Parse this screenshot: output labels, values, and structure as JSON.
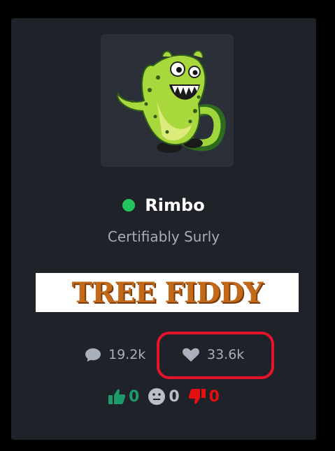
{
  "profile": {
    "name": "Rimbo",
    "subtitle": "Certifiably Surly",
    "status": "online",
    "status_color": "#22c55e",
    "banner_text": "TREE FIDDY"
  },
  "stats": {
    "comments": "19.2k",
    "likes": "33.6k"
  },
  "reactions": {
    "thumbs_up": "0",
    "neutral": "0",
    "thumbs_down": "0",
    "up_color": "#1c9a6a",
    "neutral_color": "#b9bec8",
    "down_color": "#e60f0f"
  },
  "annotation": {
    "highlight_color": "#e6142b"
  }
}
